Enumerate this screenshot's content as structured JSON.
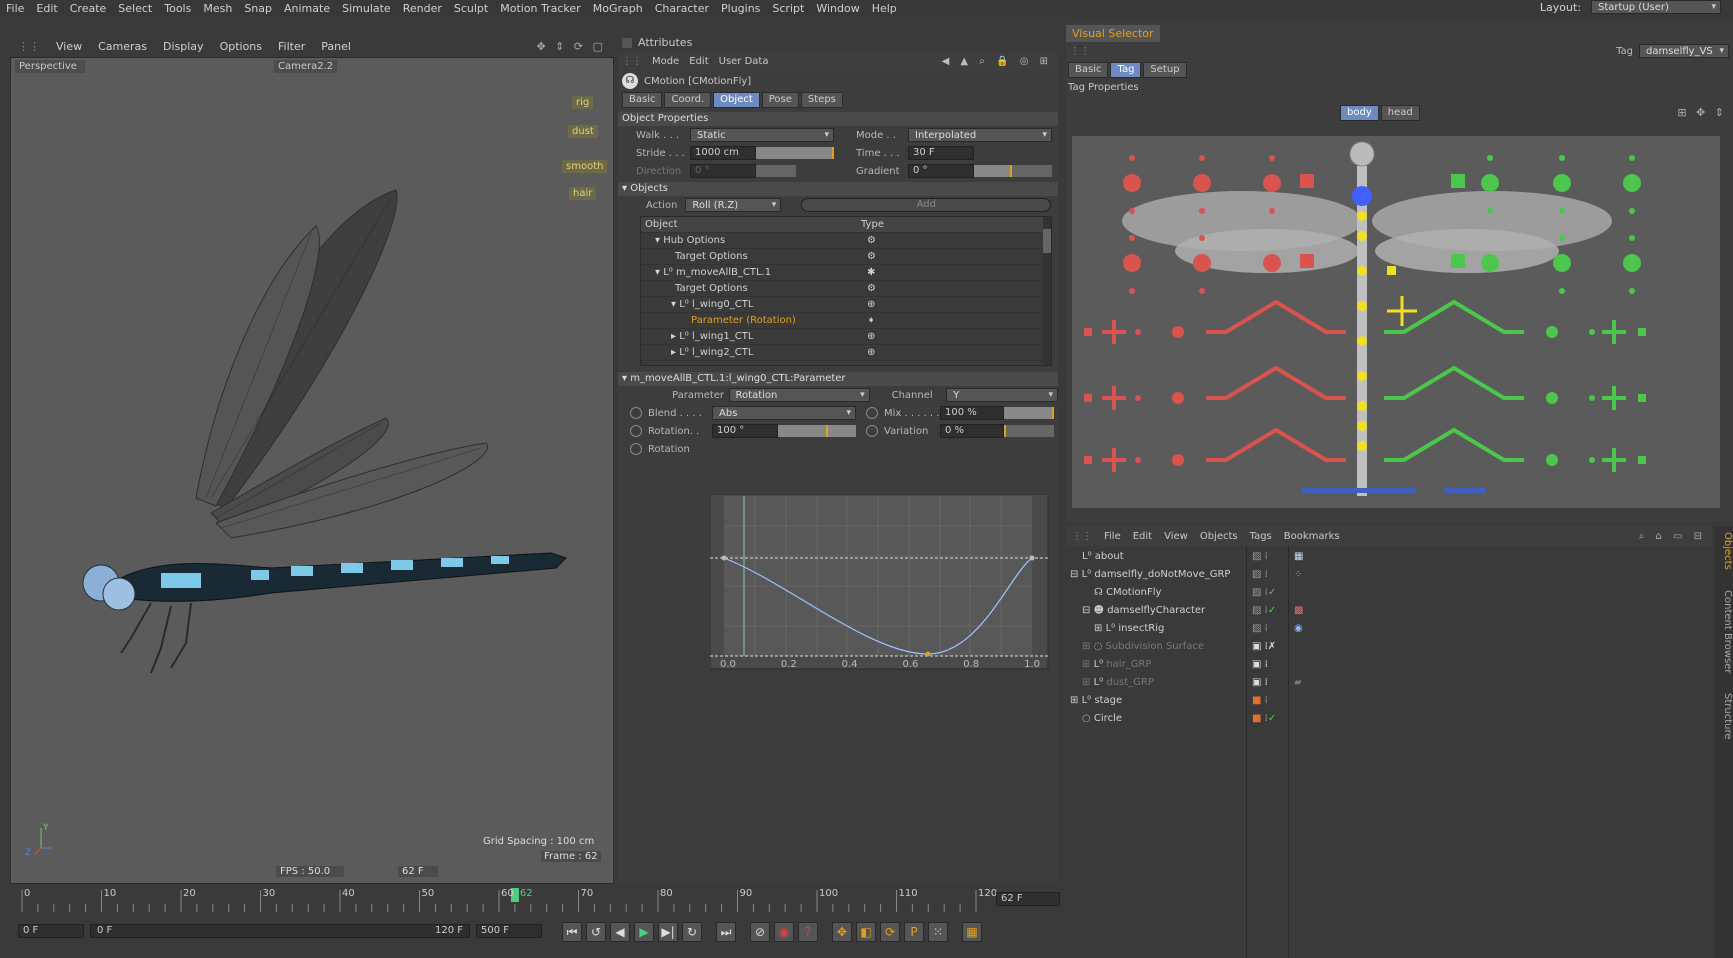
{
  "menubar": {
    "items": [
      "File",
      "Edit",
      "Create",
      "Select",
      "Tools",
      "Mesh",
      "Snap",
      "Animate",
      "Simulate",
      "Render",
      "Sculpt",
      "Motion Tracker",
      "MoGraph",
      "Character",
      "Plugins",
      "Script",
      "Window",
      "Help"
    ],
    "layout_label": "Layout:",
    "layout_value": "Startup (User)"
  },
  "viewport": {
    "menu": [
      "View",
      "Cameras",
      "Display",
      "Options",
      "Filter",
      "Panel"
    ],
    "view_name": "Perspective",
    "camera": "Camera2.2",
    "tags": [
      "rig",
      "dust",
      "smooth",
      "hair"
    ],
    "grid_spacing": "Grid Spacing : 100 cm",
    "frame": "Frame : 62",
    "fps": "FPS : 50.0",
    "frame_short": "62 F",
    "axis_y": "Y",
    "axis_z": "Z"
  },
  "attributes": {
    "title": "Attributes",
    "menu": [
      "Mode",
      "Edit",
      "User Data"
    ],
    "object_name": "CMotion [CMotionFly]",
    "tabs": [
      "Basic",
      "Coord.",
      "Object",
      "Pose",
      "Steps"
    ],
    "active_tab": "Object",
    "section_object_props": "Object Properties",
    "walk_label": "Walk . . .",
    "walk_value": "Static",
    "mode_label": "Mode . .",
    "mode_value": "Interpolated",
    "stride_label": "Stride . . .",
    "stride_value": "1000 cm",
    "time_label": "Time . . .",
    "time_value": "30 F",
    "direction_label": "Direction",
    "direction_value": "0 °",
    "gradient_label": "Gradient",
    "gradient_value": "0 °",
    "section_objects": "Objects",
    "action_label": "Action",
    "action_value": "Roll (R.Z)",
    "add_label": "Add",
    "col_object": "Object",
    "col_type": "Type",
    "tree": [
      {
        "label": "Hub Options",
        "indent": 1
      },
      {
        "label": "Target Options",
        "indent": 2
      },
      {
        "label": "m_moveAllB_CTL.1",
        "indent": 2
      },
      {
        "label": "Target Options",
        "indent": 2
      },
      {
        "label": "l_wing0_CTL",
        "indent": 3
      },
      {
        "label": "Parameter (Rotation)",
        "indent": 3,
        "highlight": true
      },
      {
        "label": "l_wing1_CTL",
        "indent": 3
      },
      {
        "label": "l_wing2_CTL",
        "indent": 3
      }
    ],
    "section_param": "m_moveAllB_CTL.1:l_wing0_CTL:Parameter",
    "parameter_label": "Parameter",
    "parameter_value": "Rotation",
    "channel_label": "Channel",
    "channel_value": "Y",
    "blend_label": "Blend . . . .",
    "blend_value": "Abs",
    "mix_label": "Mix . . . . . .",
    "mix_value": "100 %",
    "rotation_label": "Rotation. .",
    "rotation_value": "100 °",
    "variation_label": "Variation",
    "variation_value": "0 %",
    "rotation_curve_label": "Rotation",
    "curve_ticks": [
      "0.0",
      "0.2",
      "0.4",
      "0.6",
      "0.8",
      "1.0"
    ]
  },
  "visual_selector": {
    "title": "Visual Selector",
    "tag_label": "Tag",
    "tag_value": "damselfly_VS",
    "tabs": [
      "Basic",
      "Tag",
      "Setup"
    ],
    "active_tab": "Tag",
    "section": "Tag Properties",
    "body_btn": "body",
    "head_btn": "head"
  },
  "object_manager": {
    "menu": [
      "File",
      "Edit",
      "View",
      "Objects",
      "Tags",
      "Bookmarks"
    ],
    "side_tabs": [
      "Objects",
      "Content Browser",
      "Structure"
    ],
    "rows": [
      {
        "label": "about",
        "indent": 0,
        "icon": "null-icon"
      },
      {
        "label": "damselfly_doNotMove_GRP",
        "indent": 0,
        "icon": "null-icon"
      },
      {
        "label": "CMotionFly",
        "indent": 1,
        "icon": "cmotion-icon"
      },
      {
        "label": "damselflyCharacter",
        "indent": 1,
        "icon": "character-icon"
      },
      {
        "label": "insectRig",
        "indent": 2,
        "icon": "null-icon"
      },
      {
        "label": "Subdivision Surface",
        "indent": 1,
        "icon": "subdivision-icon",
        "dim": true
      },
      {
        "label": "hair_GRP",
        "indent": 1,
        "icon": "null-icon",
        "dim": true
      },
      {
        "label": "dust_GRP",
        "indent": 1,
        "icon": "null-icon",
        "dim": true
      },
      {
        "label": "stage",
        "indent": 0,
        "icon": "null-icon"
      },
      {
        "label": "Circle",
        "indent": 0,
        "icon": "circle-icon"
      }
    ]
  },
  "timeline": {
    "ticks": [
      "0",
      "10",
      "20",
      "30",
      "40",
      "50",
      "60",
      "70",
      "80",
      "90",
      "100",
      "110",
      "120"
    ],
    "current": "62",
    "current_field": "62 F",
    "start_field": "0 F",
    "range_start": "0 F",
    "range_end": "120 F",
    "end_field": "500 F",
    "current_frame": 62,
    "max_frame": 120
  },
  "colors": {
    "accent": "#6e8ac0",
    "orange": "#e2a020",
    "red": "#d9534f",
    "green": "#4cc64c",
    "yellow": "#f0e020",
    "blue": "#4060c0"
  }
}
